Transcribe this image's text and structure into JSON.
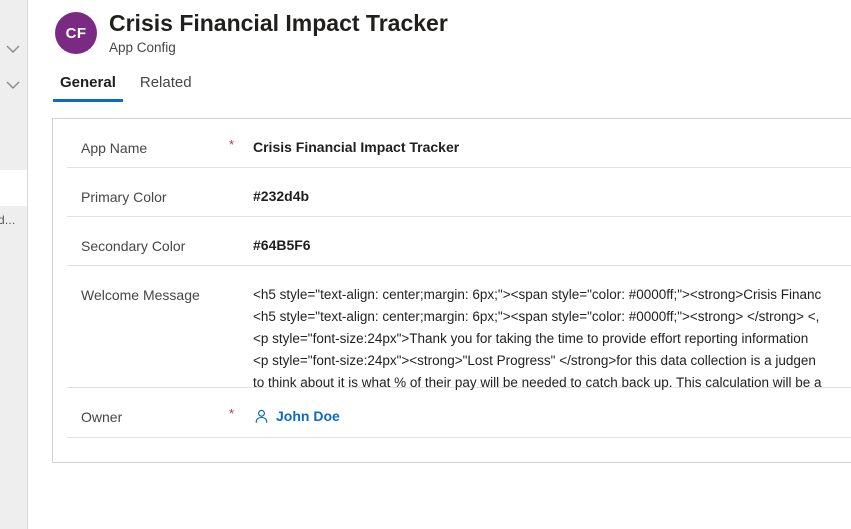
{
  "sidebar": {
    "chevron_1": "chevron-down-icon",
    "chevron_2": "chevron-down-icon",
    "partial_item_label": "d..."
  },
  "header": {
    "avatar_initials": "CF",
    "title": "Crisis Financial Impact Tracker",
    "subtitle": "App Config"
  },
  "tabs": [
    {
      "label": "General",
      "active": true
    },
    {
      "label": "Related",
      "active": false
    }
  ],
  "form": {
    "fields": [
      {
        "label": "App Name",
        "required": "*",
        "value": "Crisis Financial Impact Tracker"
      },
      {
        "label": "Primary Color",
        "required": "",
        "value": "#232d4b"
      },
      {
        "label": "Secondary Color",
        "required": "",
        "value": "#64B5F6"
      },
      {
        "label": "Welcome Message",
        "required": "",
        "value": "<h5 style=\"text-align: center;margin: 6px;\"><span style=\"color: #0000ff;\"><strong>Crisis Financ\n<h5 style=\"text-align: center;margin: 6px;\"><span style=\"color: #0000ff;\"><strong> </strong> <,\n<p style=\"font-size:24px\">Thank you for taking the time to provide effort reporting information\n<p style=\"font-size:24px\"><strong>\"Lost Progress\" </strong>for this data collection is a judgen\nto think about it is what % of their pay will be needed to catch back up. This calculation will be a"
      },
      {
        "label": "Owner",
        "required": "*",
        "value": "John Doe",
        "icon": "person-icon"
      }
    ]
  },
  "colors": {
    "accent": "#0f6cbd",
    "avatar_bg": "#7b2a84",
    "required_asterisk": "#c4314b",
    "sidebar_bg": "#eeeeee",
    "card_border": "#d1d1d1"
  }
}
